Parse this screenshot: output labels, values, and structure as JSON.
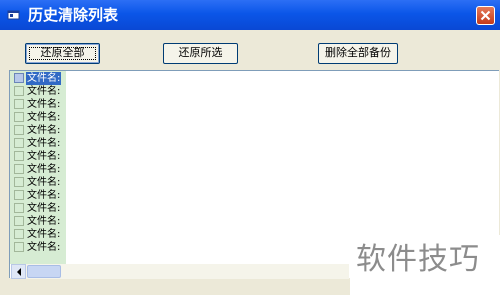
{
  "window": {
    "title": "历史清除列表",
    "title_icon": "app-window-icon",
    "close_icon": "close-icon"
  },
  "toolbar": {
    "restore_all_label": "还原全部",
    "restore_selected_label": "还原所选",
    "delete_all_backup_label": "删除全部备份"
  },
  "list": {
    "selected_index": 0,
    "items": [
      {
        "label": "文件名:"
      },
      {
        "label": "文件名:"
      },
      {
        "label": "文件名:"
      },
      {
        "label": "文件名:"
      },
      {
        "label": "文件名:"
      },
      {
        "label": "文件名:"
      },
      {
        "label": "文件名:"
      },
      {
        "label": "文件名:"
      },
      {
        "label": "文件名:"
      },
      {
        "label": "文件名:"
      },
      {
        "label": "文件名:"
      },
      {
        "label": "文件名:"
      },
      {
        "label": "文件名:"
      },
      {
        "label": "文件名:"
      }
    ]
  },
  "watermark": "软件技巧",
  "colors": {
    "titlebar": "#0b56e8",
    "selection": "#316ac5",
    "checkbox_column": "#d6ecd3",
    "window_bg": "#ece9d8"
  }
}
